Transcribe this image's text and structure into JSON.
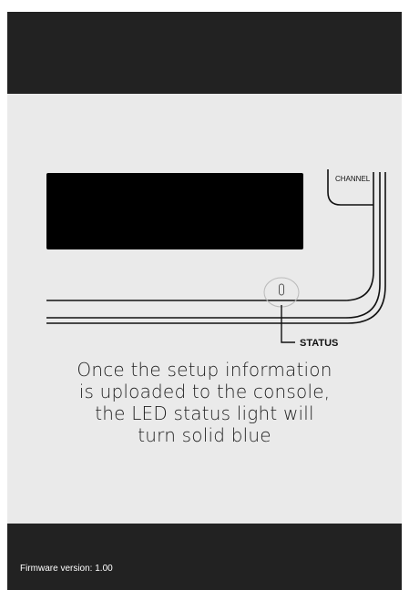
{
  "device_diagram": {
    "channel_label": "CHANNEL",
    "status_label": "STATUS"
  },
  "instruction": {
    "line1": "Once the setup information",
    "line2": "is uploaded to the console,",
    "line3": "the LED status light will",
    "line4": "turn solid blue"
  },
  "footer": {
    "firmware_text": "Firmware version: 1.00"
  },
  "colors": {
    "bar_background": "#222222",
    "panel_background": "#eaeaea",
    "screen_black": "#000000"
  }
}
